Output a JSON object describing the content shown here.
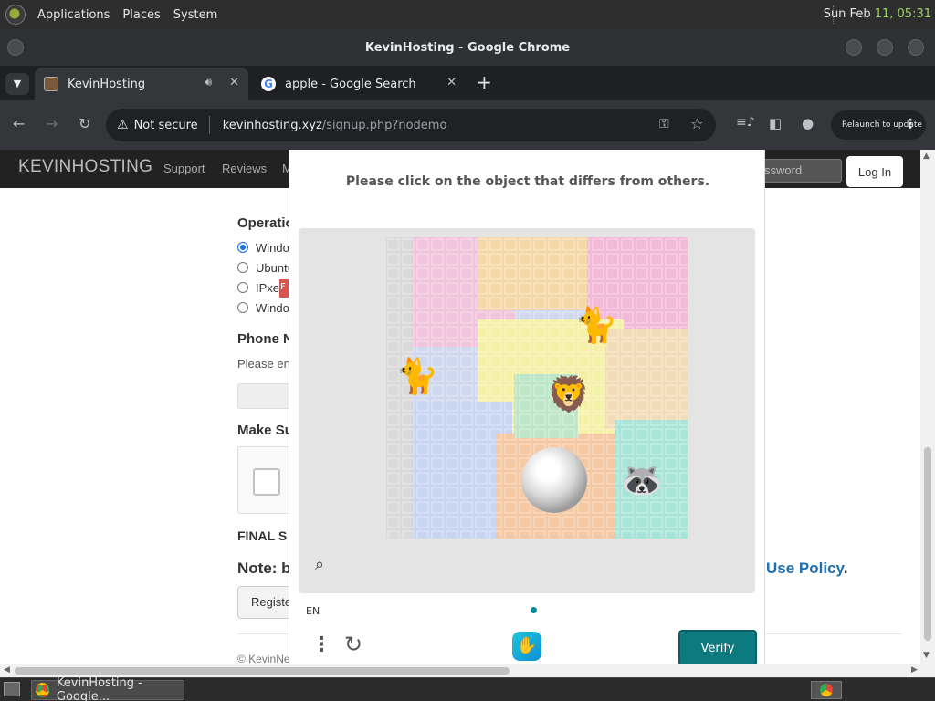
{
  "os": {
    "menus": [
      "Applications",
      "Places",
      "System"
    ],
    "clock_day": "Sun Feb",
    "clock_time": "11, 05:31"
  },
  "window": {
    "title": "KevinHosting - Google Chrome"
  },
  "tabs": [
    {
      "title": "KevinHosting"
    },
    {
      "title": "apple - Google Search"
    }
  ],
  "toolbar": {
    "security": "Not secure",
    "url_host": "kevinhosting.xyz",
    "url_path": "/signup.php?nodemo",
    "relaunch": "Relaunch to update"
  },
  "site": {
    "brand": "KEVINHOSTING",
    "nav": [
      "Support",
      "Reviews",
      "M"
    ],
    "password_placeholder": "ssword",
    "login": "Log In",
    "os_heading": "Operatio",
    "os_options": [
      "Windo",
      "Ubuntu",
      "IPxe",
      "Windo"
    ],
    "badge": "F",
    "phone_heading": "Phone N",
    "phone_hint": "Please ent",
    "make_heading": "Make Su",
    "final_heading": "FINAL S",
    "note_prefix": "Note",
    "note_text": ": b",
    "policy_link": "Use Policy",
    "policy_dot": ".",
    "register": "Registe",
    "footer": "© KevinNe"
  },
  "captcha": {
    "prompt": "Please click on the object that differs from others.",
    "language": "EN",
    "verify": "Verify"
  },
  "taskbar": {
    "chrome_item": "KevinHosting - Google..."
  }
}
